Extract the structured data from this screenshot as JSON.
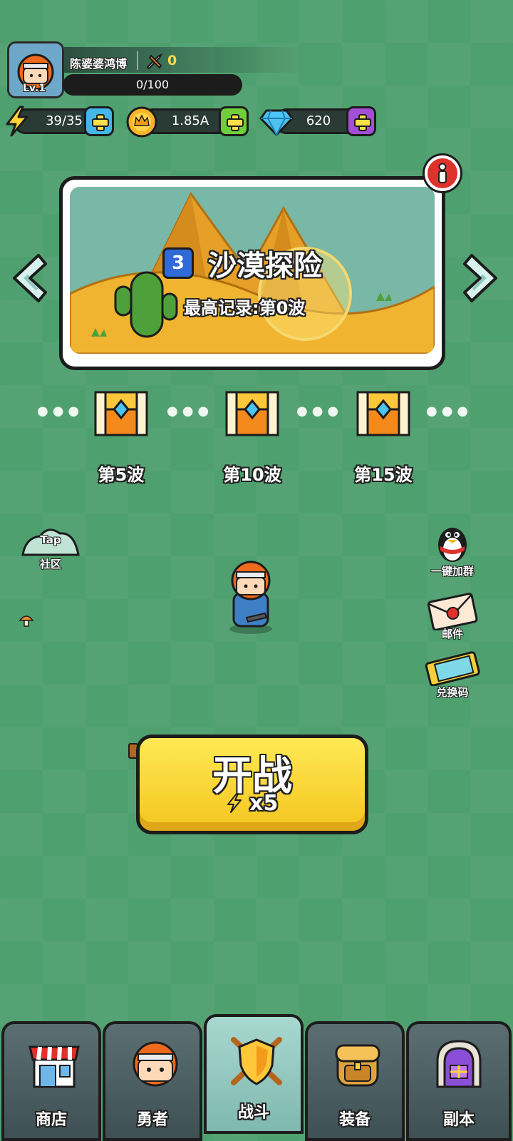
{
  "player": {
    "name": "陈婆婆鸿博",
    "level": "Lv.1",
    "trophies": "0",
    "xp": "0/100"
  },
  "resources": {
    "energy": "39/35",
    "gold": "1.85A",
    "gems": "620"
  },
  "stage": {
    "number": "3",
    "title": "沙漠探险",
    "record": "最高记录:第0波"
  },
  "waves": [
    {
      "label": "第5波"
    },
    {
      "label": "第10波"
    },
    {
      "label": "第15波"
    }
  ],
  "side_left": {
    "tap_text": "Tap",
    "community": "社区"
  },
  "side_right": {
    "join_group": "一键加群",
    "mail": "邮件",
    "redeem": "兑换码"
  },
  "start": {
    "label": "开战",
    "cost": "x5"
  },
  "nav": {
    "shop": "商店",
    "hero": "勇者",
    "battle": "战斗",
    "equipment": "装备",
    "dungeon": "副本"
  },
  "colors": {
    "background": "#4fa06f",
    "start_button": "#ffe955",
    "gem_plus": "#a24fd6",
    "gold_plus": "#6ecf3a",
    "energy_plus": "#43b8e8"
  }
}
